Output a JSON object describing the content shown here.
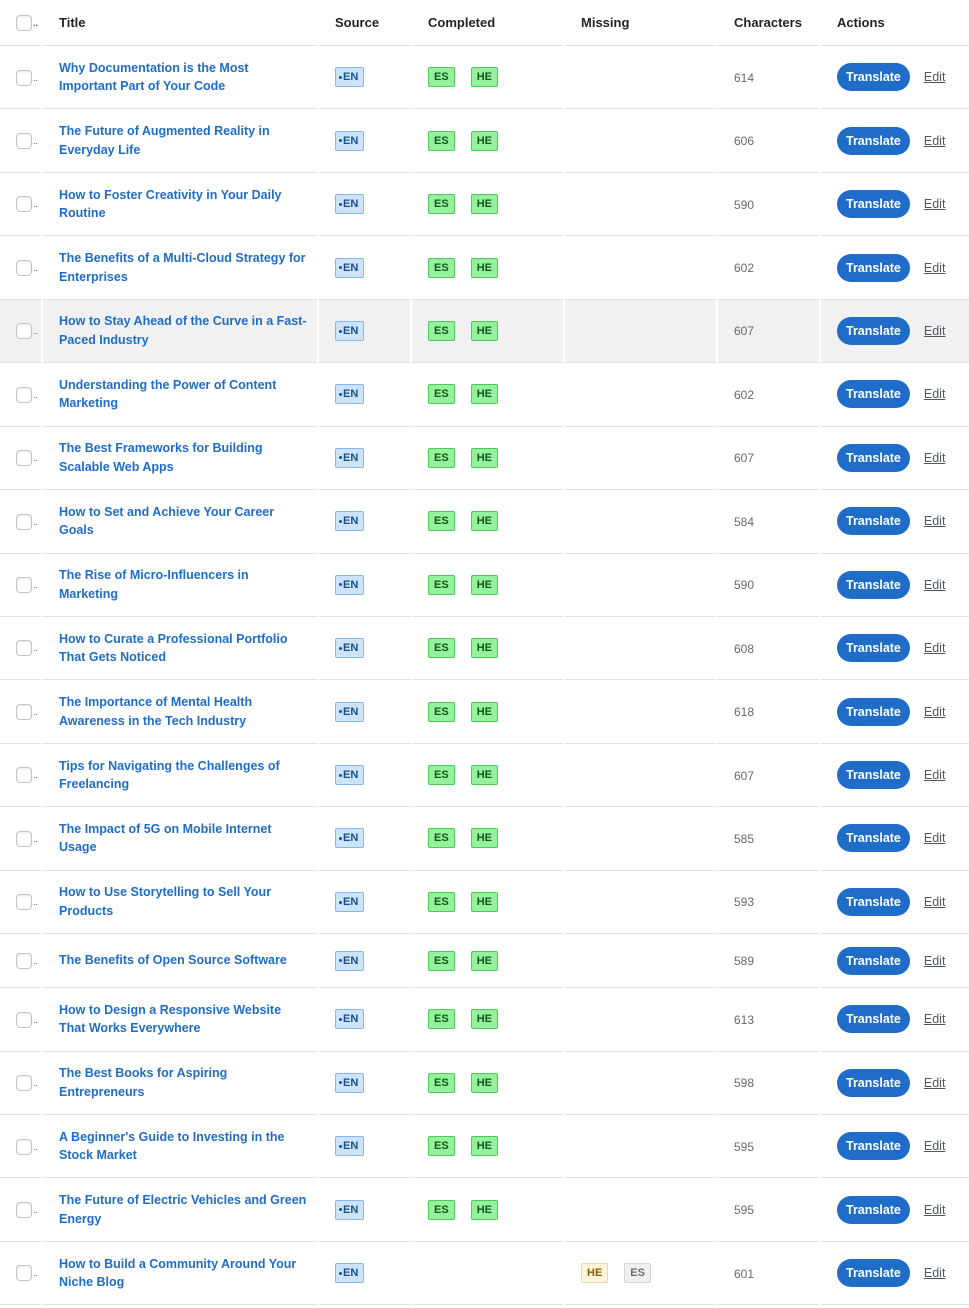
{
  "header": {
    "check_suffix": "..",
    "title": "Title",
    "source": "Source",
    "completed": "Completed",
    "missing": "Missing",
    "characters": "Characters",
    "actions": "Actions"
  },
  "actions": {
    "translate_label": "Translate",
    "edit_label": "Edit"
  },
  "rows": [
    {
      "title": "Why Documentation is the Most Important Part of Your Code",
      "source": "EN",
      "completed": [
        "ES",
        "HE"
      ],
      "missing": [],
      "characters": "614"
    },
    {
      "title": "The Future of Augmented Reality in Everyday Life",
      "source": "EN",
      "completed": [
        "ES",
        "HE"
      ],
      "missing": [],
      "characters": "606"
    },
    {
      "title": "How to Foster Creativity in Your Daily Routine",
      "source": "EN",
      "completed": [
        "ES",
        "HE"
      ],
      "missing": [],
      "characters": "590"
    },
    {
      "title": "The Benefits of a Multi-Cloud Strategy for Enterprises",
      "source": "EN",
      "completed": [
        "ES",
        "HE"
      ],
      "missing": [],
      "characters": "602"
    },
    {
      "title": "How to Stay Ahead of the Curve in a Fast-Paced Industry",
      "source": "EN",
      "completed": [
        "ES",
        "HE"
      ],
      "missing": [],
      "characters": "607",
      "highlighted": true
    },
    {
      "title": "Understanding the Power of Content Marketing",
      "source": "EN",
      "completed": [
        "ES",
        "HE"
      ],
      "missing": [],
      "characters": "602"
    },
    {
      "title": "The Best Frameworks for Building Scalable Web Apps",
      "source": "EN",
      "completed": [
        "ES",
        "HE"
      ],
      "missing": [],
      "characters": "607"
    },
    {
      "title": "How to Set and Achieve Your Career Goals",
      "source": "EN",
      "completed": [
        "ES",
        "HE"
      ],
      "missing": [],
      "characters": "584"
    },
    {
      "title": "The Rise of Micro-Influencers in Marketing",
      "source": "EN",
      "completed": [
        "ES",
        "HE"
      ],
      "missing": [],
      "characters": "590"
    },
    {
      "title": "How to Curate a Professional Portfolio That Gets Noticed",
      "source": "EN",
      "completed": [
        "ES",
        "HE"
      ],
      "missing": [],
      "characters": "608"
    },
    {
      "title": "The Importance of Mental Health Awareness in the Tech Industry",
      "source": "EN",
      "completed": [
        "ES",
        "HE"
      ],
      "missing": [],
      "characters": "618"
    },
    {
      "title": "Tips for Navigating the Challenges of Freelancing",
      "source": "EN",
      "completed": [
        "ES",
        "HE"
      ],
      "missing": [],
      "characters": "607"
    },
    {
      "title": "The Impact of 5G on Mobile Internet Usage",
      "source": "EN",
      "completed": [
        "ES",
        "HE"
      ],
      "missing": [],
      "characters": "585"
    },
    {
      "title": "How to Use Storytelling to Sell Your Products",
      "source": "EN",
      "completed": [
        "ES",
        "HE"
      ],
      "missing": [],
      "characters": "593"
    },
    {
      "title": "The Benefits of Open Source Software",
      "source": "EN",
      "completed": [
        "ES",
        "HE"
      ],
      "missing": [],
      "characters": "589",
      "short": true
    },
    {
      "title": "How to Design a Responsive Website That Works Everywhere",
      "source": "EN",
      "completed": [
        "ES",
        "HE"
      ],
      "missing": [],
      "characters": "613"
    },
    {
      "title": "The Best Books for Aspiring Entrepreneurs",
      "source": "EN",
      "completed": [
        "ES",
        "HE"
      ],
      "missing": [],
      "characters": "598"
    },
    {
      "title": "A Beginner's Guide to Investing in the Stock Market",
      "source": "EN",
      "completed": [
        "ES",
        "HE"
      ],
      "missing": [],
      "characters": "595"
    },
    {
      "title": "The Future of Electric Vehicles and Green Energy",
      "source": "EN",
      "completed": [
        "ES",
        "HE"
      ],
      "missing": [],
      "characters": "595"
    },
    {
      "title": "How to Build a Community Around Your Niche Blog",
      "source": "EN",
      "completed": [],
      "missing": [
        "HE",
        "ES"
      ],
      "characters": "601"
    }
  ]
}
